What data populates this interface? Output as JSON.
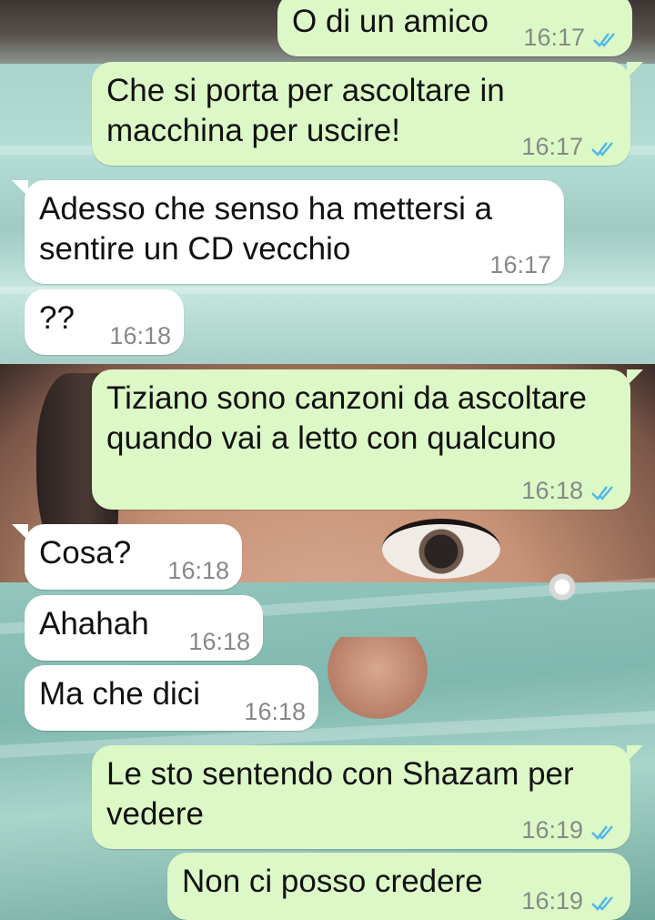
{
  "messages": [
    {
      "direction": "outgoing",
      "text": "O di un amico",
      "time": "16:17",
      "status": "read"
    },
    {
      "direction": "outgoing",
      "text": "Che si porta per ascoltare in\nmacchina per uscire!",
      "time": "16:17",
      "status": "read"
    },
    {
      "direction": "incoming",
      "text": "Adesso che senso ha mettersi a\nsentire un CD vecchio",
      "time": "16:17"
    },
    {
      "direction": "incoming",
      "text": "??",
      "time": "16:18"
    },
    {
      "direction": "outgoing",
      "text": "Tiziano sono canzoni da ascoltare\nquando vai a letto con qualcuno",
      "time": "16:18",
      "status": "read"
    },
    {
      "direction": "incoming",
      "text": "Cosa?",
      "time": "16:18"
    },
    {
      "direction": "incoming",
      "text": "Ahahah",
      "time": "16:18"
    },
    {
      "direction": "incoming",
      "text": "Ma che dici",
      "time": "16:18"
    },
    {
      "direction": "outgoing",
      "text": "Le sto sentendo con Shazam per\nvedere",
      "time": "16:19",
      "status": "read"
    },
    {
      "direction": "outgoing",
      "text": "Non ci posso credere",
      "time": "16:19",
      "status": "read"
    }
  ],
  "colors": {
    "outgoing_bubble": "#dcf8c6",
    "incoming_bubble": "#ffffff",
    "read_ticks": "#4fb6ec",
    "timestamp": "#858a86"
  },
  "icons": {
    "read_status": "double-check-icon"
  }
}
